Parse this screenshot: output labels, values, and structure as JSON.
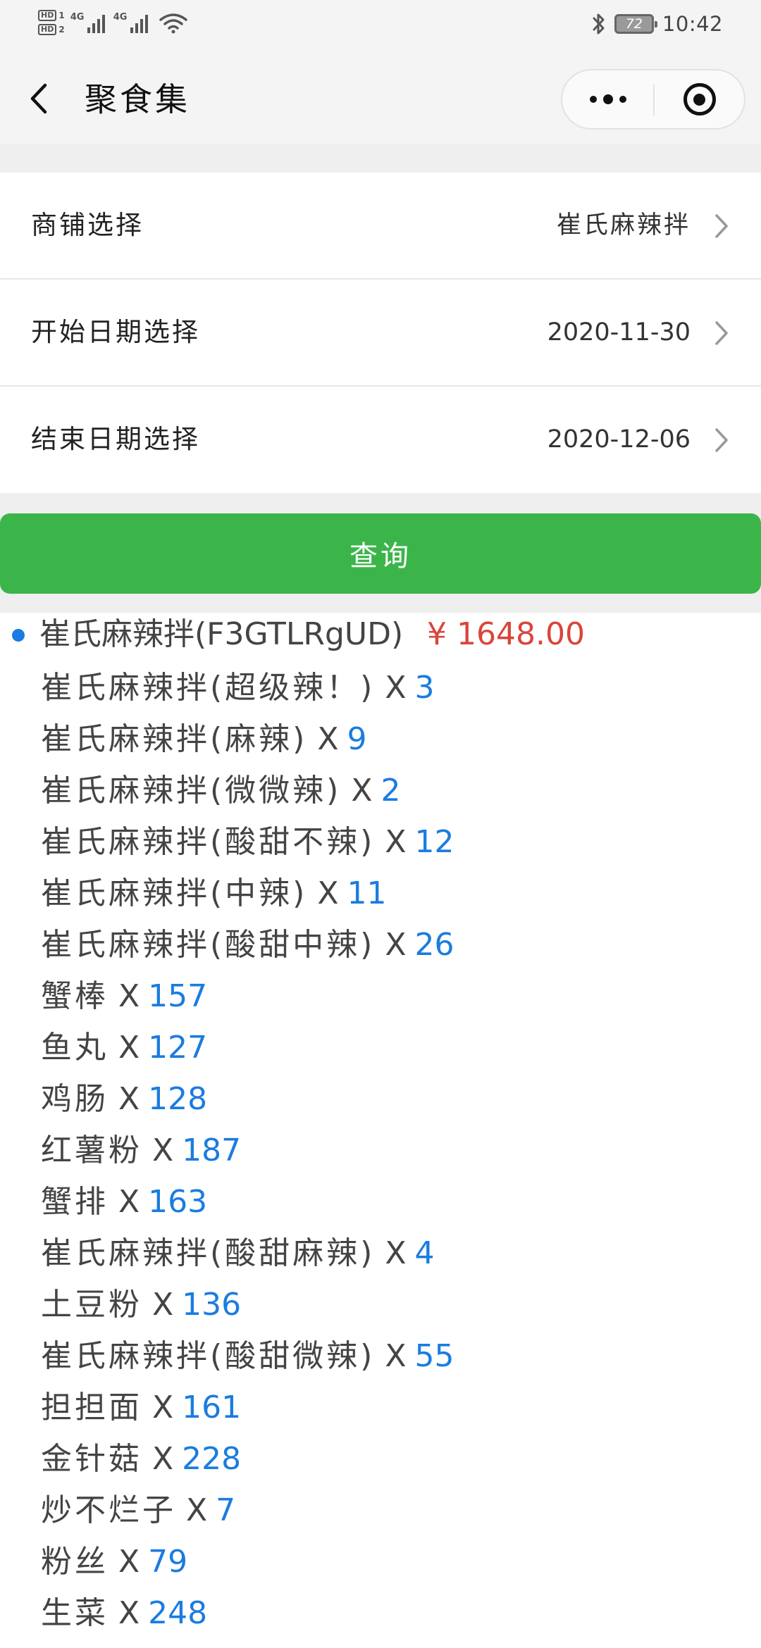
{
  "status_bar": {
    "hd1": "HD",
    "hd1_num": "1",
    "hd2": "HD",
    "hd2_num": "2",
    "net1": "4G",
    "net2": "4G",
    "battery": "72",
    "time": "10:42"
  },
  "nav": {
    "title": "聚食集"
  },
  "form": {
    "shop_label": "商铺选择",
    "shop_value": "崔氏麻辣拌",
    "start_label": "开始日期选择",
    "start_value": "2020-11-30",
    "end_label": "结束日期选择",
    "end_value": "2020-12-06"
  },
  "query_button": "查询",
  "results": {
    "shop_name": "崔氏麻辣拌(F3GTLRgUD)",
    "total": "¥ 1648.00",
    "multiplier": "X",
    "items": [
      {
        "name": "崔氏麻辣拌(超级辣！)",
        "qty": "3"
      },
      {
        "name": "崔氏麻辣拌(麻辣)",
        "qty": "9"
      },
      {
        "name": "崔氏麻辣拌(微微辣)",
        "qty": "2"
      },
      {
        "name": "崔氏麻辣拌(酸甜不辣)",
        "qty": "12"
      },
      {
        "name": "崔氏麻辣拌(中辣)",
        "qty": "11"
      },
      {
        "name": "崔氏麻辣拌(酸甜中辣)",
        "qty": "26"
      },
      {
        "name": "蟹棒",
        "qty": "157"
      },
      {
        "name": "鱼丸",
        "qty": "127"
      },
      {
        "name": "鸡肠",
        "qty": "128"
      },
      {
        "name": "红薯粉",
        "qty": "187"
      },
      {
        "name": "蟹排",
        "qty": "163"
      },
      {
        "name": "崔氏麻辣拌(酸甜麻辣)",
        "qty": "4"
      },
      {
        "name": "土豆粉",
        "qty": "136"
      },
      {
        "name": "崔氏麻辣拌(酸甜微辣)",
        "qty": "55"
      },
      {
        "name": "担担面",
        "qty": "161"
      },
      {
        "name": "金针菇",
        "qty": "228"
      },
      {
        "name": "炒不烂子",
        "qty": "7"
      },
      {
        "name": "粉丝",
        "qty": "79"
      },
      {
        "name": "生菜",
        "qty": "248"
      }
    ]
  },
  "colors": {
    "accent_green": "#3bb54a",
    "price_red": "#d9453b",
    "qty_blue": "#1a7ce0"
  }
}
